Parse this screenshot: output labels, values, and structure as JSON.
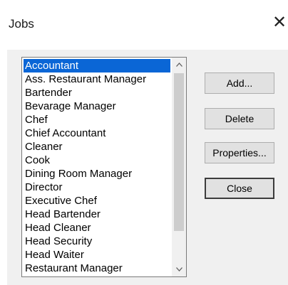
{
  "window": {
    "title": "Jobs",
    "close_glyph": "✕"
  },
  "jobs": {
    "items": [
      "Accountant",
      "Ass. Restaurant Manager",
      "Bartender",
      "Bevarage Manager",
      "Chef",
      "Chief Accountant",
      "Cleaner",
      "Cook",
      "Dining Room Manager",
      "Director",
      "Executive Chef",
      "Head Bartender",
      "Head Cleaner",
      "Head Security",
      "Head Waiter",
      "Restaurant Manager"
    ],
    "selected_index": 0
  },
  "scrollbar": {
    "up_icon": "chevron-up-icon",
    "down_icon": "chevron-down-icon"
  },
  "buttons": {
    "add": "Add...",
    "delete": "Delete",
    "properties": "Properties...",
    "close": "Close"
  }
}
